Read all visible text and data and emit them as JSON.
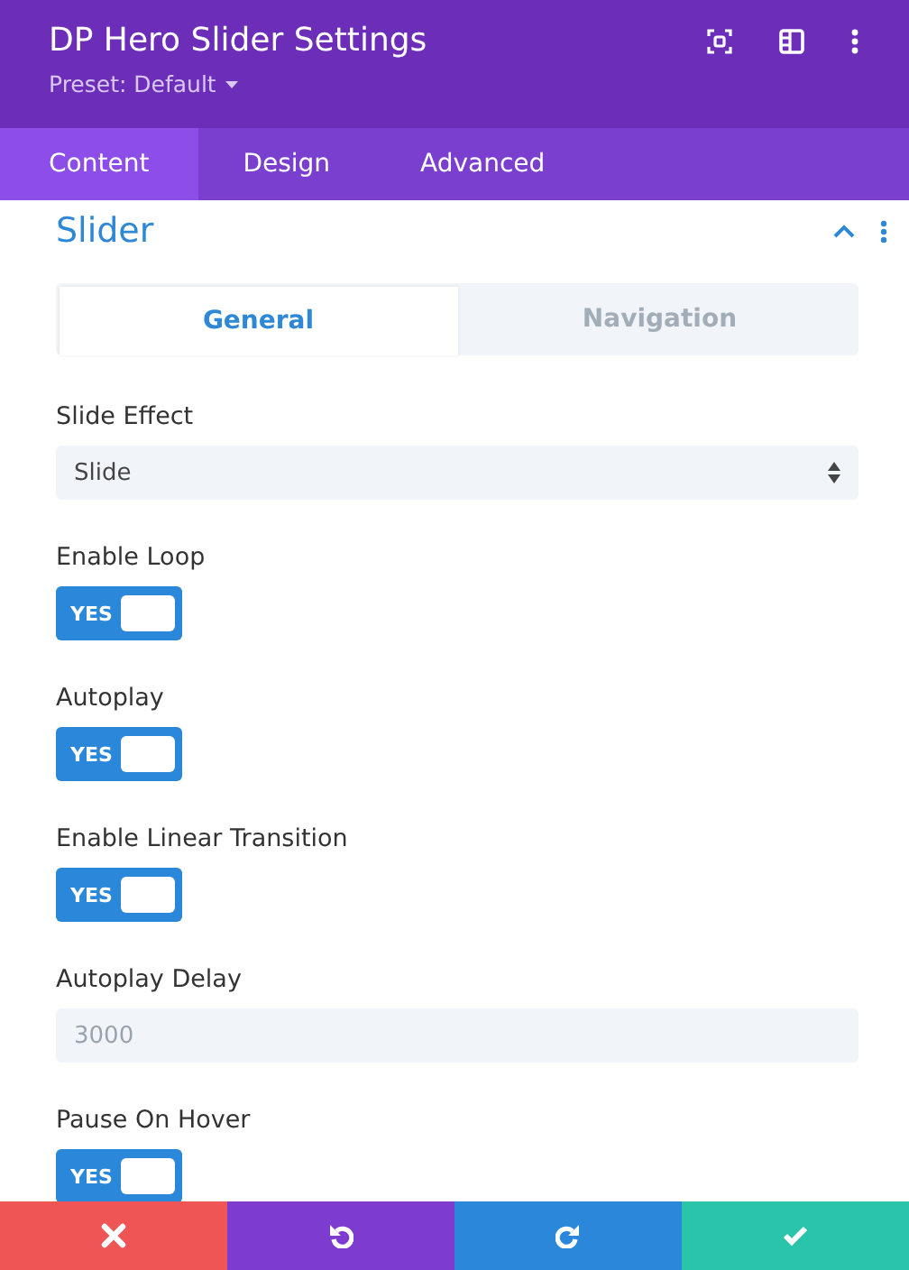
{
  "window": {
    "title": "DP Hero Slider Settings",
    "preset": "Preset: Default"
  },
  "tabs": [
    {
      "label": "Content",
      "selected": true
    },
    {
      "label": "Design",
      "selected": false
    },
    {
      "label": "Advanced",
      "selected": false
    }
  ],
  "section": {
    "title": "Slider",
    "expanded": true
  },
  "subtabs": [
    {
      "label": "General",
      "selected": true
    },
    {
      "label": "Navigation",
      "selected": false
    }
  ],
  "fields": [
    {
      "kind": "select",
      "label": "Slide Effect",
      "value": "Slide"
    },
    {
      "kind": "toggle",
      "label": "Enable Loop",
      "on": true,
      "text": "YES"
    },
    {
      "kind": "toggle",
      "label": "Autoplay",
      "on": true,
      "text": "YES"
    },
    {
      "kind": "toggle",
      "label": "Enable Linear Transition",
      "on": true,
      "text": "YES"
    },
    {
      "kind": "input",
      "label": "Autoplay Delay",
      "placeholder": "3000"
    },
    {
      "kind": "toggle",
      "label": "Pause On Hover",
      "on": true,
      "text": "YES"
    }
  ],
  "actions": [
    {
      "kind": "discard"
    },
    {
      "kind": "undo"
    },
    {
      "kind": "redo"
    },
    {
      "kind": "save"
    }
  ]
}
